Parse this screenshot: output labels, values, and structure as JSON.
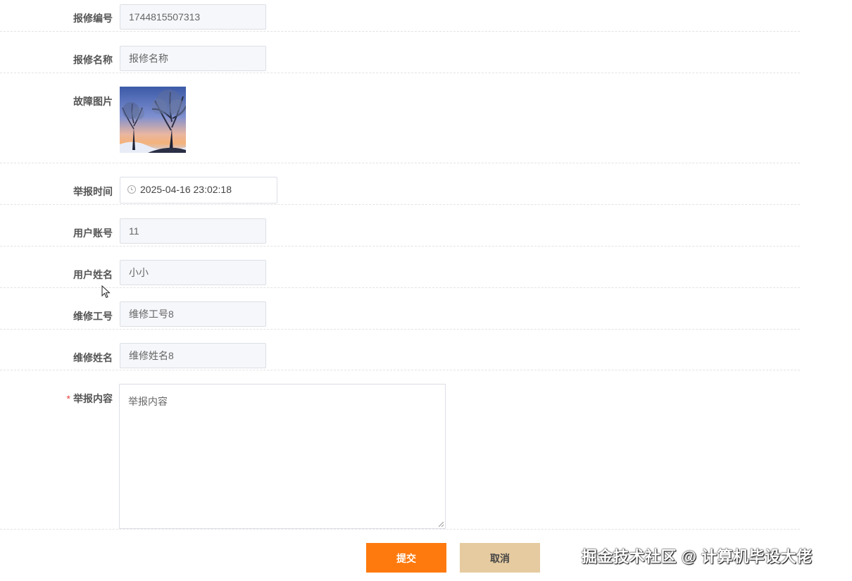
{
  "form": {
    "fields": {
      "repair_no": {
        "label": "报修编号",
        "value": "1744815507313"
      },
      "repair_name": {
        "label": "报修名称",
        "value": "报修名称"
      },
      "fault_image": {
        "label": "故障图片"
      },
      "report_time": {
        "label": "举报时间",
        "value": "2025-04-16 23:02:18"
      },
      "user_account": {
        "label": "用户账号",
        "value": "11"
      },
      "user_name": {
        "label": "用户姓名",
        "value": "小小"
      },
      "worker_no": {
        "label": "维修工号",
        "value": "维修工号8"
      },
      "worker_name": {
        "label": "维修姓名",
        "value": "维修姓名8"
      },
      "report_content": {
        "label": "举报内容",
        "required_mark": "*",
        "placeholder": "举报内容"
      }
    },
    "buttons": {
      "submit": "提交",
      "cancel": "取消"
    }
  },
  "watermark": "掘金技术社区 @ 计算机毕设大佬",
  "colors": {
    "submit_bg": "#ff7a0e",
    "cancel_bg": "#e6cba0",
    "required": "#e5453d",
    "readonly_bg": "#f5f7fa"
  }
}
